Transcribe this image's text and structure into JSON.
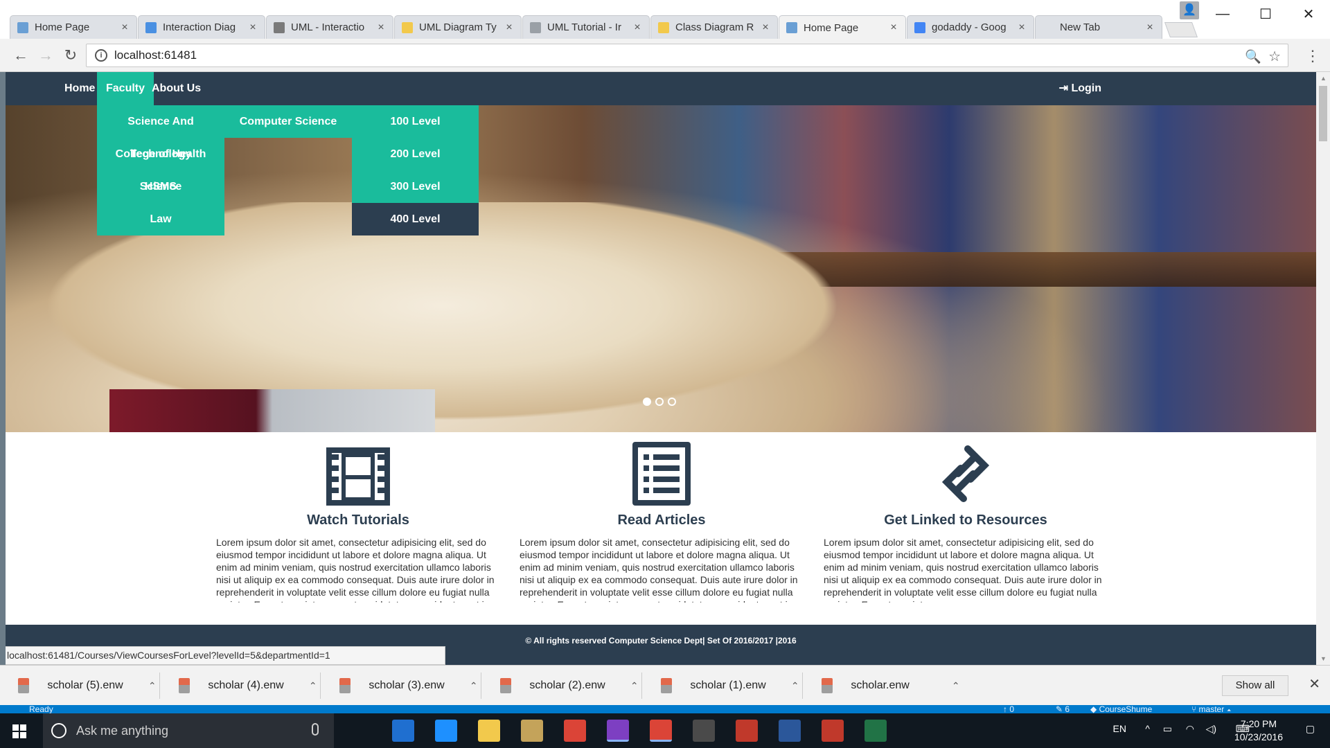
{
  "browser": {
    "tabs": [
      {
        "title": "Home Page",
        "fav": "#6a9fd4",
        "active": false
      },
      {
        "title": "Interaction Diag",
        "fav": "#4a90e2",
        "active": false
      },
      {
        "title": "UML - Interactio",
        "fav": "#7a7a7a",
        "active": false
      },
      {
        "title": "UML Diagram Ty",
        "fav": "#f2c94c",
        "active": false
      },
      {
        "title": "UML Tutorial - Ir",
        "fav": "#9aa0a6",
        "active": false
      },
      {
        "title": "Class Diagram R",
        "fav": "#f2c94c",
        "active": false
      },
      {
        "title": "Home Page",
        "fav": "#6a9fd4",
        "active": true
      },
      {
        "title": "godaddy - Goog",
        "fav": "#4285f4",
        "active": false
      },
      {
        "title": "New Tab",
        "fav": "",
        "active": false
      }
    ],
    "address": "localhost:61481",
    "status_url": "localhost:61481/Courses/ViewCoursesForLevel?levelId=5&departmentId=1"
  },
  "site": {
    "nav": {
      "home": "Home",
      "faculty": "Faculty",
      "about": "About Us",
      "login": "Login"
    },
    "faculty_menu": [
      "Science And Technology",
      "College of Health Science",
      "HSMS",
      "Law"
    ],
    "department_menu": [
      "Computer Science"
    ],
    "level_menu": [
      {
        "label": "100 Level",
        "highlighted": false
      },
      {
        "label": "200 Level",
        "highlighted": false
      },
      {
        "label": "300 Level",
        "highlighted": false
      },
      {
        "label": "400 Level",
        "highlighted": true
      }
    ],
    "carousel_active": 1,
    "carousel_count": 3,
    "features": [
      {
        "icon": "film-icon",
        "title": "Watch Tutorials",
        "text": "Lorem ipsum dolor sit amet, consectetur adipisicing elit, sed do eiusmod tempor incididunt ut labore et dolore magna aliqua. Ut enim ad minim veniam, quis nostrud exercitation ullamco laboris nisi ut aliquip ex ea commodo consequat. Duis aute irure dolor in reprehenderit in voluptate velit esse cillum dolore eu fugiat nulla pariatur. Excepteur sint occaecat cupidatat non proident, sunt in culpa qui officia"
      },
      {
        "icon": "list-icon",
        "title": "Read Articles",
        "text": "Lorem ipsum dolor sit amet, consectetur adipisicing elit, sed do eiusmod tempor incididunt ut labore et dolore magna aliqua. Ut enim ad minim veniam, quis nostrud exercitation ullamco laboris nisi ut aliquip ex ea commodo consequat. Duis aute irure dolor in reprehenderit in voluptate velit esse cillum dolore eu fugiat nulla pariatur. Excepteur sint occaecat cupidatat non proident, sunt in culpa qui officia"
      },
      {
        "icon": "link-icon",
        "title": "Get Linked to Resources",
        "text": "Lorem ipsum dolor sit amet, consectetur adipisicing elit, sed do eiusmod tempor incididunt ut labore et dolore magna aliqua. Ut enim ad minim veniam, quis nostrud exercitation ullamco laboris nisi ut aliquip ex ea commodo consequat. Duis aute irure dolor in reprehenderit in voluptate velit esse cillum dolore eu fugiat nulla pariatur. Excepteur sint"
      }
    ],
    "footer": "© All rights reserved Computer Science Dept| Set Of 2016/2017 |2016"
  },
  "downloads": {
    "files": [
      "scholar (5).enw",
      "scholar (4).enw",
      "scholar (3).enw",
      "scholar (2).enw",
      "scholar (1).enw",
      "scholar.enw"
    ],
    "show_all": "Show all"
  },
  "ide_status": {
    "left": "Ready",
    "up": "0",
    "edits": "6",
    "project": "CourseShume",
    "branch": "master"
  },
  "taskbar": {
    "search_placeholder": "Ask me anything",
    "lang": "EN",
    "time": "7:20 PM",
    "date": "10/23/2016",
    "pinned": [
      {
        "name": "task-view-icon",
        "color": "#101820"
      },
      {
        "name": "store-icon",
        "color": "#1f6fd0"
      },
      {
        "name": "edge-icon",
        "color": "#1e90ff"
      },
      {
        "name": "file-explorer-icon",
        "color": "#f2c94c"
      },
      {
        "name": "tools-icon",
        "color": "#c4a35a"
      },
      {
        "name": "chrome-icon",
        "color": "#db4437"
      },
      {
        "name": "visual-studio-icon",
        "color": "#7d3fc2"
      },
      {
        "name": "chrome-active-icon",
        "color": "#db4437"
      },
      {
        "name": "sublime-icon",
        "color": "#4a4a4a"
      },
      {
        "name": "git-icon",
        "color": "#c0392b"
      },
      {
        "name": "word-icon",
        "color": "#2b579a"
      },
      {
        "name": "endnote-icon",
        "color": "#c0392b"
      },
      {
        "name": "project-icon",
        "color": "#217346"
      }
    ]
  }
}
